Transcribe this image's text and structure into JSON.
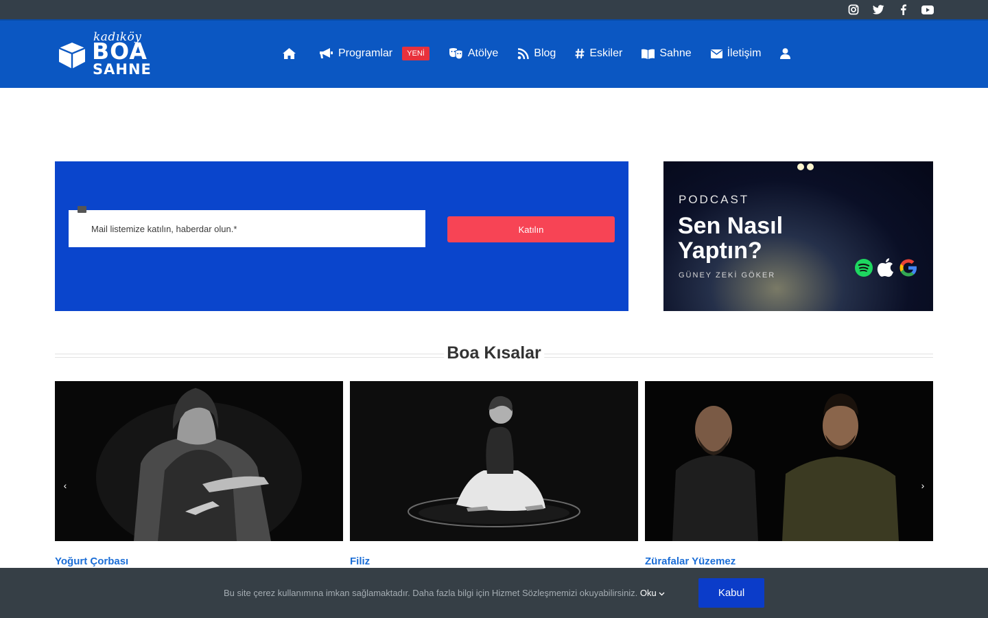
{
  "header": {
    "logo": {
      "small": "kadıköy",
      "big": "BOA",
      "sub": "SAHNE"
    },
    "nav": {
      "programs": "Programlar",
      "badge": "YENİ",
      "workshop": "Atölye",
      "blog": "Blog",
      "archive": "Eskiler",
      "stage": "Sahne",
      "contact": "İletişim"
    },
    "social": [
      "instagram-icon",
      "twitter-icon",
      "facebook-icon",
      "youtube-icon"
    ]
  },
  "newsletter": {
    "placeholder": "Mail listemize katılın, haberdar olun.*",
    "button": "Katılın"
  },
  "podcast": {
    "label": "PODCAST",
    "title_line1": "Sen Nasıl",
    "title_line2": "Yaptın?",
    "author": "GÜNEY ZEKİ GÖKER"
  },
  "section": {
    "title": "Boa Kısalar"
  },
  "cards": [
    {
      "title": "Yoğurt Çorbası"
    },
    {
      "title": "Filiz"
    },
    {
      "title": "Zürafalar Yüzemez"
    }
  ],
  "cookie": {
    "text": "Bu site çerez kullanımına imkan sağlamaktadır. Daha fazla bilgi için Hizmet Sözleşmemizi okuyabilirsiniz.",
    "more": "Oku",
    "accept": "Kabul"
  },
  "colors": {
    "topbar": "#343f49",
    "header": "#0b57c2",
    "newsletter": "#0a45cc",
    "button": "#f74455",
    "link": "#1a6dd6",
    "cookie": "#363f46",
    "cookie_button": "#0b3cc9"
  }
}
